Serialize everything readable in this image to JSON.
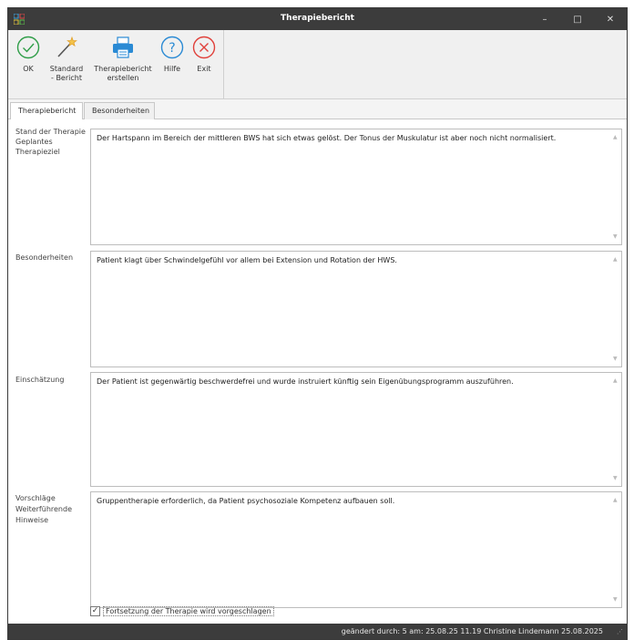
{
  "window": {
    "title": "Therapiebericht"
  },
  "titlebar_buttons": {
    "minimize": "–",
    "maximize": "□",
    "close": "✕"
  },
  "colors": {
    "ok": "#2e9d47",
    "help": "#2a8ad4",
    "exit": "#e0403a",
    "wand": "#e2a12a",
    "printer": "#2a8ad4",
    "titlebar": "#3c3c3c"
  },
  "ribbon": {
    "ok": "OK",
    "standard": "Standard\n- Bericht",
    "print": "Therapiebericht\nerstellen",
    "help": "Hilfe",
    "exit": "Exit"
  },
  "tabs": [
    "Therapiebericht",
    "Besonderheiten"
  ],
  "fields": [
    {
      "label": "Stand der Therapie\nGeplantes\nTherapieziel",
      "value": "Der Hartspann im Bereich der mittleren BWS hat sich etwas gelöst. Der Tonus der Muskulatur ist aber noch nicht normalisiert."
    },
    {
      "label": "Besonderheiten",
      "value": "Patient klagt über Schwindelgefühl vor allem bei Extension und Rotation der HWS."
    },
    {
      "label": "Einschätzung",
      "value": "Der Patient ist gegenwärtig beschwerdefrei und wurde instruiert künftig sein Eigenübungsprogramm auszuführen."
    },
    {
      "label": "Vorschläge\nWeiterführende\nHinweise",
      "value": "Gruppentherapie erforderlich, da Patient psychosoziale Kompetenz aufbauen soll."
    }
  ],
  "checkbox": {
    "label": "Fortsetzung der Therapie wird vorgeschlagen",
    "checked": true
  },
  "status": "geändert durch: 5 am: 25.08.25 11.19   Christine Lindemann   25.08.2025"
}
